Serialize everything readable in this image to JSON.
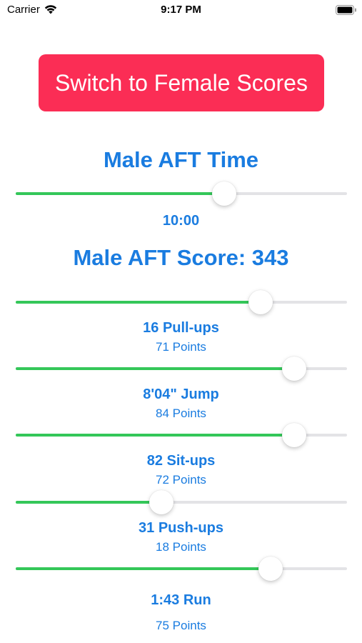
{
  "status_bar": {
    "carrier": "Carrier",
    "time": "9:17 PM"
  },
  "switch_button": {
    "label": "Switch to Female Scores",
    "color": "#fb2d55"
  },
  "time_section": {
    "title": "Male AFT Time",
    "slider_value": 0.63,
    "value_label": "10:00"
  },
  "score_title": "Male AFT Score: 343",
  "events": [
    {
      "name": "16 Pull-ups",
      "points": "71 Points",
      "slider_value": 0.74
    },
    {
      "name": "8'04\" Jump",
      "points": "84 Points",
      "slider_value": 0.84
    },
    {
      "name": "82 Sit-ups",
      "points": "72 Points",
      "slider_value": 0.84
    },
    {
      "name": "31 Push-ups",
      "points": "18 Points",
      "slider_value": 0.44
    },
    {
      "name": "1:43 Run",
      "points": "75 Points",
      "slider_value": 0.77
    }
  ],
  "colors": {
    "accent_text": "#1a7ce0",
    "slider_fill": "#34c759",
    "slider_track": "#e3e3e6"
  },
  "icons": [
    "wifi-icon",
    "battery-icon"
  ]
}
